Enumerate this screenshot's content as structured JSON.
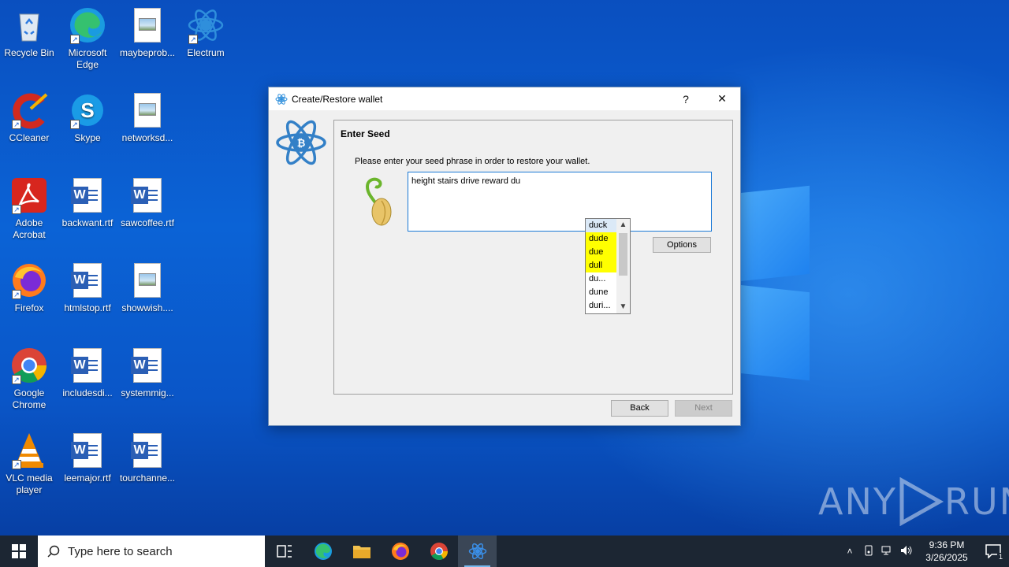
{
  "desktop": {
    "icons": [
      {
        "label": "Recycle Bin",
        "icon": "recycle-bin-icon"
      },
      {
        "label": "Microsoft Edge",
        "icon": "edge-icon"
      },
      {
        "label": "maybeprob...",
        "icon": "image-file-icon"
      },
      {
        "label": "Electrum",
        "icon": "electrum-icon"
      },
      {
        "label": "CCleaner",
        "icon": "ccleaner-icon"
      },
      {
        "label": "Skype",
        "icon": "skype-icon"
      },
      {
        "label": "networksd...",
        "icon": "image-file-icon"
      },
      {
        "label": "Adobe Acrobat",
        "icon": "acrobat-icon"
      },
      {
        "label": "backwant.rtf",
        "icon": "word-file-icon"
      },
      {
        "label": "sawcoffee.rtf",
        "icon": "word-file-icon"
      },
      {
        "label": "Firefox",
        "icon": "firefox-icon"
      },
      {
        "label": "htmlstop.rtf",
        "icon": "word-file-icon"
      },
      {
        "label": "showwish....",
        "icon": "image-file-icon"
      },
      {
        "label": "Google Chrome",
        "icon": "chrome-icon"
      },
      {
        "label": "includesdi...",
        "icon": "word-file-icon"
      },
      {
        "label": "systemmig...",
        "icon": "word-file-icon"
      },
      {
        "label": "VLC media player",
        "icon": "vlc-icon"
      },
      {
        "label": "leemajor.rtf",
        "icon": "word-file-icon"
      },
      {
        "label": "tourchanne...",
        "icon": "word-file-icon"
      }
    ]
  },
  "dialog": {
    "title": "Create/Restore wallet",
    "help_label": "?",
    "close_label": "✕",
    "panel_title": "Enter Seed",
    "message": "Please enter your seed phrase in order to restore your wallet.",
    "seed_value": "height stairs drive reward du",
    "options_label": "Options",
    "back_label": "Back",
    "next_label": "Next",
    "completions": [
      {
        "word": "duck",
        "state": "selected"
      },
      {
        "word": "dude",
        "state": "highlight"
      },
      {
        "word": "due",
        "state": "highlight"
      },
      {
        "word": "dull",
        "state": "highlight"
      },
      {
        "word": "du...",
        "state": "normal"
      },
      {
        "word": "dune",
        "state": "normal"
      },
      {
        "word": "duri...",
        "state": "normal"
      }
    ],
    "colors": {
      "highlight": "#ffff00",
      "selected": "#dbe9f7",
      "accent": "#1b7ad6"
    }
  },
  "watermark": {
    "text_left": "ANY",
    "text_right": "RUN"
  },
  "taskbar": {
    "search_placeholder": "Type here to search",
    "apps": [
      "task-view-icon",
      "edge-icon",
      "file-explorer-icon",
      "firefox-icon",
      "chrome-icon",
      "electrum-icon"
    ],
    "active_app": "electrum-icon",
    "time": "9:36 PM",
    "date": "3/26/2025",
    "notification_count": "1"
  }
}
